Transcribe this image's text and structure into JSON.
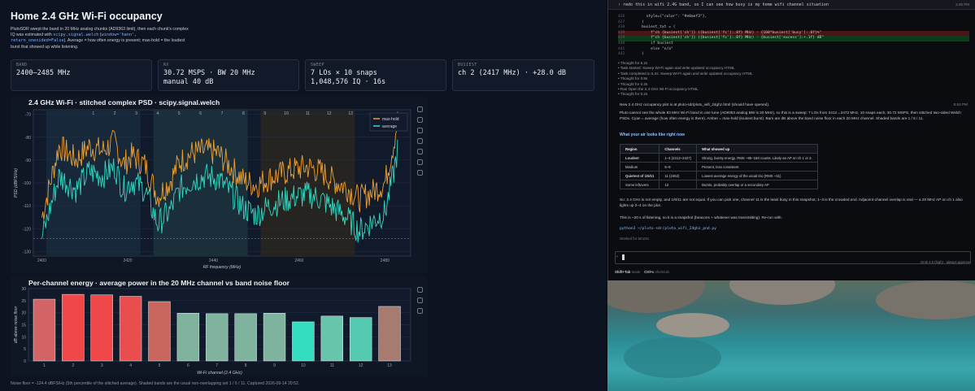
{
  "dashboard": {
    "title": "Home 2.4 GHz Wi-Fi occupancy",
    "desc_1": "PlutoSDR swept the band in 20 MHz analog chunks (AD9363 limit), then each chunk's complex IQ was estimated with ",
    "desc_code_1": "scipy.signal.welch",
    "desc_2": " (",
    "desc_code_2": "window='hann', return_onesided=False",
    "desc_3": "). Average = how often energy is present; max-hold = the loudest burst that showed up while listening.",
    "stats": [
      {
        "label": "BAND",
        "line1": "2400–2485 MHz",
        "line2": ""
      },
      {
        "label": "RX",
        "line1": "30.72 MSPS · BW 20 MHz",
        "line2": "manual 40 dB"
      },
      {
        "label": "SWEEP",
        "line1": "7 LOs × 10 snaps",
        "line2": "1,048,576 IQ · 16s"
      },
      {
        "label": "BUSIEST",
        "line1": "ch 2 (2417 MHz) · +28.0 dB",
        "line2": ""
      }
    ],
    "footer": "Noise floor = -124.4 dBFS/Hz (5th percentile of the stitched average). Shaded bands are the usual non-overlapping set 1 / 6 / 11. Captured 2026-09-14 20:52."
  },
  "psd_chart": {
    "title": "2.4 GHz Wi-Fi · stitched complex PSD · scipy.signal.welch",
    "xlabel": "RF frequency (MHz)",
    "ylabel": "PSD (dBFS/Hz)",
    "type": "line",
    "xlim": [
      2398,
      2486
    ],
    "ylim": [
      -132,
      -68
    ],
    "xticks": [
      2400,
      2420,
      2440,
      2460,
      2480
    ],
    "yticks": [
      -70,
      -80,
      -90,
      -100,
      -110,
      -120,
      -130
    ],
    "channel_labels": [
      "1",
      "2",
      "3",
      "4",
      "5",
      "6",
      "7",
      "8",
      "9",
      "10",
      "11",
      "12",
      "13"
    ],
    "channel_centers": [
      2412,
      2417,
      2422,
      2427,
      2432,
      2437,
      2442,
      2447,
      2452,
      2457,
      2462,
      2467,
      2472
    ],
    "shaded_bands": [
      [
        2401,
        2423
      ],
      [
        2426,
        2448
      ],
      [
        2451,
        2473
      ]
    ],
    "noise_floor": -124.4,
    "legend": [
      {
        "name": "max-hold",
        "color": "#f0a030"
      },
      {
        "name": "average",
        "color": "#2fd9c1"
      }
    ]
  },
  "bar_chart": {
    "title": "Per-channel energy · average power in the 20 MHz channel vs band noise floor",
    "xlabel": "Wi-Fi channel (2.4 GHz)",
    "ylabel": "dB above noise floor",
    "type": "bar",
    "ylim": [
      0,
      30
    ],
    "yticks": [
      0,
      5,
      10,
      15,
      20,
      25,
      30
    ],
    "categories": [
      "1",
      "2",
      "3",
      "4",
      "5",
      "6",
      "7",
      "8",
      "9",
      "10",
      "11",
      "12",
      "13"
    ],
    "values": [
      25.6,
      27.6,
      27.4,
      26.8,
      24.6,
      19.8,
      19.6,
      19.6,
      19.8,
      16.2,
      18.6,
      18.0,
      22.6
    ],
    "colors": [
      "#d26466",
      "#f04848",
      "#f04848",
      "#ea4d4e",
      "#c9675f",
      "#7fb39d",
      "#7fb39d",
      "#7fb39d",
      "#7fb39d",
      "#35ddc0",
      "#67c5ac",
      "#54cbb0",
      "#a77b6f"
    ]
  },
  "chart_data": [
    {
      "type": "line",
      "title": "2.4 GHz Wi-Fi · stitched complex PSD · scipy.signal.welch",
      "xlabel": "RF frequency (MHz)",
      "ylabel": "PSD (dBFS/Hz)",
      "xlim": [
        2398,
        2486
      ],
      "ylim": [
        -132,
        -68
      ],
      "series": [
        {
          "name": "max-hold",
          "x": [
            2400,
            2404,
            2408,
            2411,
            2414,
            2417,
            2419,
            2421,
            2424,
            2427,
            2430,
            2432,
            2435,
            2438,
            2441,
            2444,
            2447,
            2450,
            2453,
            2456,
            2459,
            2462,
            2465,
            2468,
            2471,
            2474,
            2477,
            2480,
            2482,
            2483
          ],
          "values": [
            -115,
            -84,
            -90,
            -84,
            -86,
            -82,
            -92,
            -88,
            -92,
            -106,
            -99,
            -91,
            -87,
            -86,
            -87,
            -93,
            -99,
            -101,
            -98,
            -96,
            -94,
            -93,
            -95,
            -99,
            -102,
            -107,
            -104,
            -100,
            -83,
            -72
          ]
        },
        {
          "name": "average",
          "x": [
            2400,
            2404,
            2408,
            2411,
            2414,
            2417,
            2419,
            2421,
            2424,
            2427,
            2430,
            2432,
            2435,
            2438,
            2441,
            2444,
            2447,
            2450,
            2453,
            2456,
            2459,
            2462,
            2465,
            2468,
            2471,
            2474,
            2477,
            2480,
            2482,
            2483
          ],
          "values": [
            -124,
            -97,
            -103,
            -95,
            -97,
            -93,
            -103,
            -99,
            -103,
            -118,
            -112,
            -103,
            -99,
            -97,
            -98,
            -104,
            -111,
            -114,
            -110,
            -108,
            -106,
            -105,
            -107,
            -111,
            -115,
            -121,
            -117,
            -113,
            -96,
            -85
          ]
        }
      ],
      "legend": "top-right"
    },
    {
      "type": "bar",
      "title": "Per-channel energy · average power in the 20 MHz channel vs band noise floor",
      "xlabel": "Wi-Fi channel (2.4 GHz)",
      "ylabel": "dB above noise floor",
      "categories": [
        "1",
        "2",
        "3",
        "4",
        "5",
        "6",
        "7",
        "8",
        "9",
        "10",
        "11",
        "12",
        "13"
      ],
      "values": [
        25.6,
        27.6,
        27.4,
        26.8,
        24.6,
        19.8,
        19.6,
        19.6,
        19.8,
        16.2,
        18.6,
        18.0,
        22.6
      ],
      "ylim": [
        0,
        30
      ]
    }
  ],
  "terminal": {
    "prompt": "› redo this in wifi 2.4G band, so I can see how busy is my home wifi channel situation",
    "prompt_time": "2:45 PM",
    "code_lines": [
      {
        "n": "426",
        "t": "      style={\"color\": \"#e0aef3\"},",
        "k": ""
      },
      {
        "n": "427",
        "t": "    )",
        "k": ""
      },
      {
        "n": "438",
        "t": "    busiest_txt = (",
        "k": ""
      },
      {
        "n": "439",
        "t": "        f\"ch {busiest['ch']} ({busiest['fc']:.0f} MHz) · {100*busiest['busy']:.0f}%\"",
        "k": "del"
      },
      {
        "n": "439",
        "t": "        f\"ch {busiest['ch']} ({busiest['fc']:.0f} MHz) · {busiest['excess']:+.1f} dB\"",
        "k": "add"
      },
      {
        "n": "440",
        "t": "        if busiest",
        "k": ""
      },
      {
        "n": "441",
        "t": "        else \"n/a\"",
        "k": ""
      },
      {
        "n": "442",
        "t": "    )",
        "k": ""
      }
    ],
    "log_lines": [
      "• Thought for 5.2s",
      "• Task started: Sweep Wi-Fi again and write updated occupancy HTML",
      "• Task completed in 5.2s: Sweep Wi-Fi again and write updated occupancy HTML",
      "• Thought for 0.8s",
      "• Thought for 0.3s",
      "• Ran Open the 2.4 GHz Wi-Fi occupancy HTML",
      "• Thought for 0.2s"
    ],
    "msg1": "New 2.4 GHz occupancy plot is at pluto-sdr/pluto_wifi_24ghz.html (should have opened).",
    "msg1_time": "8:53 PM",
    "msg2": "Pluto cannot see the whole 83 MHz Wi-Fi band in one tune (AD9363 analog BW is 20 MHz), so this is a sweep: 7 LOs from 2412→2472 MHz, 10 snaps each, 30.72 MSPS, then stitched two-sided Welch PSDs. Cyan = average (how often energy is there). Amber = max-hold (loudest burst). Bars are dB above the band noise floor in each 20 MHz channel. Shaded bands are 1 / 6 / 11.",
    "table_heading": "What your air looks like right now",
    "table_headers": [
      "Region",
      "Channels",
      "What showed up"
    ],
    "table_rows": [
      [
        "Loudest",
        "1–4 (2412–2427)",
        "Strong, bursty energy. RMS ~95–150 counts. Likely an AP on ch 1 or 3."
      ],
      [
        "Medium",
        "5–9",
        "Present, less consistent"
      ],
      [
        "Quietest of 1/6/11",
        "11 (2462)",
        "Lowest average energy of the usual trio (RMS ~31)"
      ],
      [
        "Some leftovers",
        "13",
        "Bursts, probably overlap or a secondary AP"
      ]
    ],
    "msg3": "So: 2.4 GHz is not empty, and 1/6/11 are not equal. If you can pick one, channel 11 is the least busy in this snapshot; 1–3 is the crowded end. Adjacent-channel overlap is real — a 20 MHz AP on ch 1 also lights up 2–4 on the plot.",
    "msg4": "This is ~20 s of listening, so it is a snapshot (beacons + whatever was transmitting). Re-run with:",
    "cmd": "python3 ~/pluto-sdr/pluto_wifi_24ghz_pnd.py",
    "worked": "Worked for 5m23s",
    "input_gt": "›",
    "model": "Grok 4.0 (high) · always-approve",
    "hint_key1": "Shift+Tab",
    "hint_txt1": " mode",
    "hint_key2": "Ctrl+c",
    "hint_txt2": " shortcuts"
  }
}
